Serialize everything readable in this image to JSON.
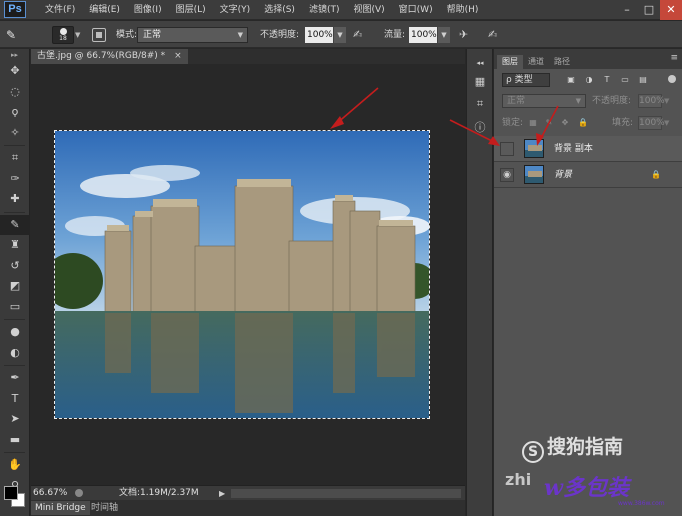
{
  "app": {
    "logo": "Ps",
    "menu": [
      "文件(F)",
      "编辑(E)",
      "图像(I)",
      "图层(L)",
      "文字(Y)",
      "选择(S)",
      "滤镜(T)",
      "视图(V)",
      "窗口(W)",
      "帮助(H)"
    ],
    "window_controls": [
      "–",
      "□",
      "✕"
    ]
  },
  "options_bar": {
    "tool_glyph": "✎",
    "brush_size": "18",
    "mode_label": "模式:",
    "mode_value": "正常",
    "opacity_label": "不透明度:",
    "opacity_value": "100%",
    "flow_label": "流量:",
    "flow_value": "100%"
  },
  "toolbar": {
    "tools": [
      {
        "name": "move-tool",
        "glyph": "✥"
      },
      {
        "name": "marquee-tool",
        "glyph": "◌"
      },
      {
        "name": "lasso-tool",
        "glyph": "ϙ"
      },
      {
        "name": "quick-select-tool",
        "glyph": "✧"
      },
      {
        "name": "crop-tool",
        "glyph": "⌗"
      },
      {
        "name": "eyedropper-tool",
        "glyph": "✑"
      },
      {
        "name": "healing-brush-tool",
        "glyph": "✚"
      },
      {
        "name": "brush-tool",
        "glyph": "✎"
      },
      {
        "name": "clone-stamp-tool",
        "glyph": "♜"
      },
      {
        "name": "history-brush-tool",
        "glyph": "↺"
      },
      {
        "name": "eraser-tool",
        "glyph": "◩"
      },
      {
        "name": "gradient-tool",
        "glyph": "▭"
      },
      {
        "name": "blur-tool",
        "glyph": "●"
      },
      {
        "name": "dodge-tool",
        "glyph": "◐"
      },
      {
        "name": "pen-tool",
        "glyph": "✒"
      },
      {
        "name": "type-tool",
        "glyph": "T"
      },
      {
        "name": "path-select-tool",
        "glyph": "➤"
      },
      {
        "name": "shape-tool",
        "glyph": "▬"
      },
      {
        "name": "hand-tool",
        "glyph": "✋"
      },
      {
        "name": "zoom-tool",
        "glyph": "⚲"
      }
    ],
    "active_tool": "brush-tool",
    "foreground_color": "#000000",
    "background_color": "#ffffff"
  },
  "document": {
    "tab_label": "古堡.jpg @ 66.7%(RGB/8#) *",
    "tab_close": "×",
    "zoom": "66.67%",
    "doc_size": "文档:1.19M/2.37M",
    "status_arrow": "▶"
  },
  "bottom_tabs": [
    "Mini Bridge",
    "时间轴"
  ],
  "layers_panel": {
    "tabs": [
      "图层",
      "通道",
      "路径"
    ],
    "active_tab": "图层",
    "menu_glyph": "≡",
    "filter_label": "ρ 类型",
    "blend_mode": "正常",
    "opacity_label": "不透明度:",
    "opacity_value": "100%",
    "lock_label": "锁定:",
    "fill_label": "填充:",
    "fill_value": "100%",
    "layers": [
      {
        "name": "背景 副本",
        "selected": true,
        "visible": false,
        "locked": false,
        "italic": false
      },
      {
        "name": "背景",
        "selected": false,
        "visible": true,
        "locked": true,
        "italic": true
      }
    ]
  },
  "watermarks": {
    "sogou": "搜狗指南",
    "zhi": "zhi",
    "site_brand": "w多包装",
    "site_url": "www.386w.com"
  },
  "colors": {
    "annotation_arrow": "#c41d1d",
    "panel_bg": "#535353",
    "app_bg": "#282828"
  }
}
